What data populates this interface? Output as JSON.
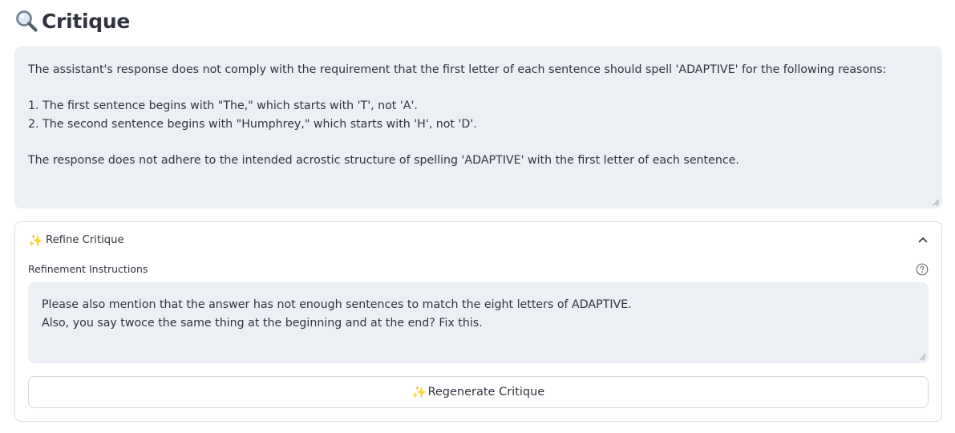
{
  "header": {
    "icon": "magnifier-icon",
    "title": "Critique"
  },
  "critique": {
    "lines": [
      "The assistant's response does not comply with the requirement that the first letter of each sentence should spell 'ADAPTIVE' for the following reasons:",
      "",
      "1. The first sentence begins with \"The,\" which starts with 'T', not 'A'.",
      "2. The second sentence begins with \"Humphrey,\" which starts with 'H', not 'D'.",
      "",
      "The response does not adhere to the intended acrostic structure of spelling 'ADAPTIVE' with the first letter of each sentence."
    ]
  },
  "refine": {
    "icon": "sparkles-icon",
    "header_label": "Refine Critique",
    "expanded": true,
    "field_label": "Refinement Instructions",
    "instructions_lines": [
      "Please also mention that the answer has not enough sentences to match the eight letters of ADAPTIVE.",
      "Also, you say twoce the same thing at the beginning and at the end? Fix this."
    ],
    "regenerate_label": "Regenerate Critique",
    "regenerate_icon": "sparkles-icon"
  },
  "colors": {
    "text": "#31333f",
    "input_bg": "#eceff4",
    "border": "#dcdde3"
  }
}
